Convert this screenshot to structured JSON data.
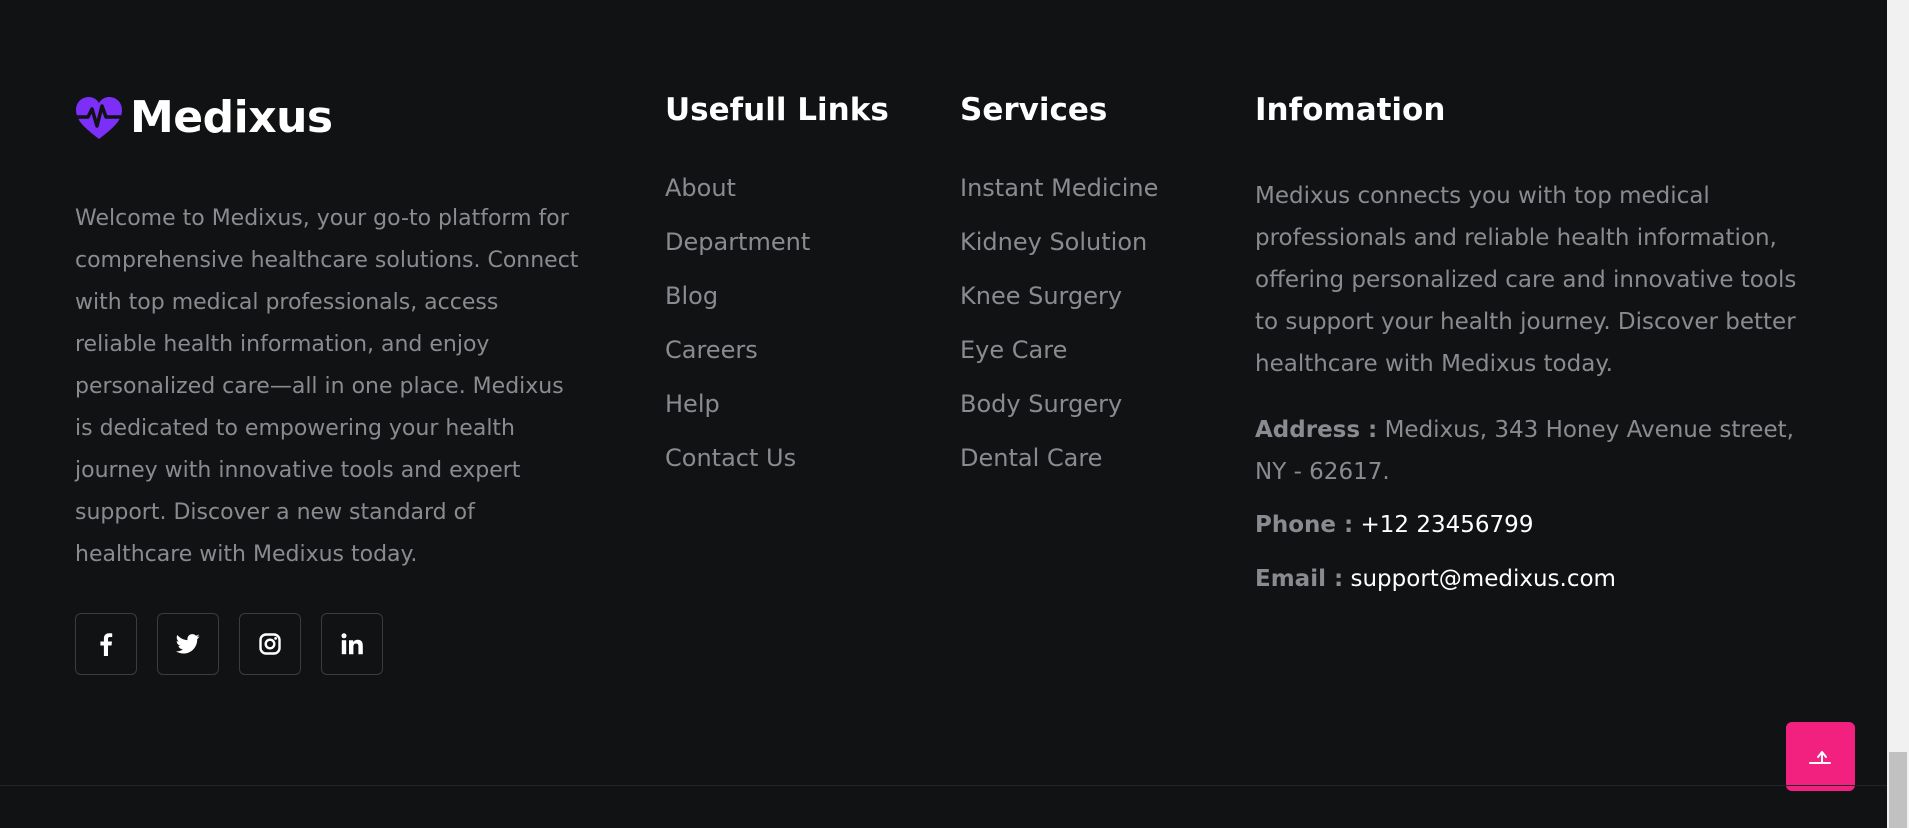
{
  "brand": {
    "name": "Medixus",
    "logo_icon": "heartbeat-icon",
    "logo_color": "#7b2ff7"
  },
  "about": {
    "text": "Welcome to Medixus, your go-to platform for comprehensive healthcare solutions. Connect with top medical professionals, access reliable health information, and enjoy personalized care—all in one place. Medixus is dedicated to empowering your health journey with innovative tools and expert support. Discover a new standard of healthcare with Medixus today."
  },
  "socials": [
    {
      "icon": "facebook-icon"
    },
    {
      "icon": "twitter-icon"
    },
    {
      "icon": "instagram-icon"
    },
    {
      "icon": "linkedin-icon"
    }
  ],
  "useful_links": {
    "heading": "Usefull Links",
    "items": [
      "About",
      "Department",
      "Blog",
      "Careers",
      "Help",
      "Contact Us"
    ]
  },
  "services": {
    "heading": "Services",
    "items": [
      "Instant Medicine",
      "Kidney Solution",
      "Knee Surgery",
      "Eye Care",
      "Body Surgery",
      "Dental Care"
    ]
  },
  "information": {
    "heading": "Infomation",
    "text": "Medixus connects you with top medical professionals and reliable health information, offering personalized care and innovative tools to support your health journey. Discover better healthcare with Medixus today.",
    "address_label": "Address :",
    "address_value": "Medixus, 343 Honey Avenue street, NY - 62617.",
    "phone_label": "Phone :",
    "phone_value": "+12 23456799",
    "email_label": "Email :",
    "email_value": "support@medixus.com"
  },
  "back_to_top": {
    "icon": "arrow-up-icon",
    "color": "#f2207f"
  },
  "colors": {
    "background": "#111214",
    "text_muted": "#8a8b90",
    "text_light": "#ffffff"
  }
}
